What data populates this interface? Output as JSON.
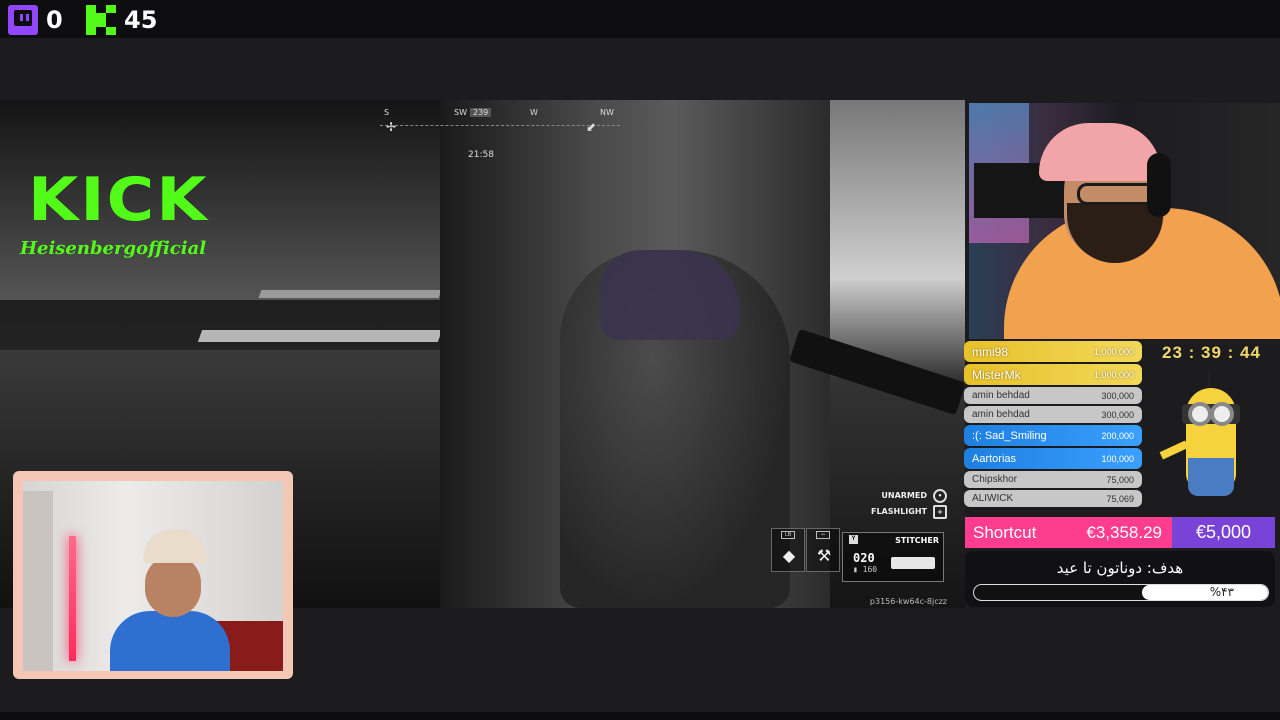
{
  "platforms": {
    "twitch": {
      "icon": "twitch-icon",
      "count": "0",
      "color": "#9146ff"
    },
    "kick": {
      "icon": "kick-icon",
      "count": "45",
      "color": "#53fc18"
    }
  },
  "branding": {
    "logo_text": "KICK",
    "username": "Heisenbergofficial"
  },
  "game_hud": {
    "compass": {
      "s": "S",
      "sw": "SW",
      "heading": "239",
      "w": "W",
      "nw": "NW"
    },
    "match_time": "21:58",
    "actions": [
      {
        "label": "UNARMED",
        "icon": "button-icon"
      },
      {
        "label": "FLASHLIGHT",
        "icon": "dpad-icon"
      }
    ],
    "slots": [
      {
        "key": "LB",
        "glyph": "◆"
      },
      {
        "key": "⇦",
        "glyph": "⚒"
      }
    ],
    "weapon": {
      "key": "Y",
      "name": "STITCHER",
      "ammo": "020",
      "reserve": "160"
    },
    "session_id": "p3156-kw64c-8jczz"
  },
  "donations": [
    {
      "name": "mmi98",
      "amount": "1,000,000",
      "tier": "gold"
    },
    {
      "name": "MisterMk",
      "amount": "1,000,000",
      "tier": "gold"
    },
    {
      "name": "amin behdad",
      "amount": "300,000",
      "tier": "grey"
    },
    {
      "name": "amin behdad",
      "amount": "300,000",
      "tier": "grey"
    },
    {
      "name": ":(: Sad_Smiling",
      "amount": "200,000",
      "tier": "blue"
    },
    {
      "name": "Aartorias",
      "amount": "100,000",
      "tier": "blue"
    },
    {
      "name": "Chipskhor",
      "amount": "75,000",
      "tier": "grey"
    },
    {
      "name": "ALIWICK",
      "amount": "75,069",
      "tier": "grey"
    }
  ],
  "countdown": "23 : 39 : 44",
  "goal_bar": {
    "name": "Shortcut",
    "amount": "€3,358.29",
    "target": "€5,000"
  },
  "goal_panel": {
    "title": "هدف: دوناتون تا عید",
    "percent_label": "%۴۳",
    "progress": 0.43
  },
  "colors": {
    "accent_kick": "#53fc18",
    "goal_pink": "#ff3d8f",
    "goal_purple": "#7a43d8",
    "countdown": "#f2d86a"
  }
}
